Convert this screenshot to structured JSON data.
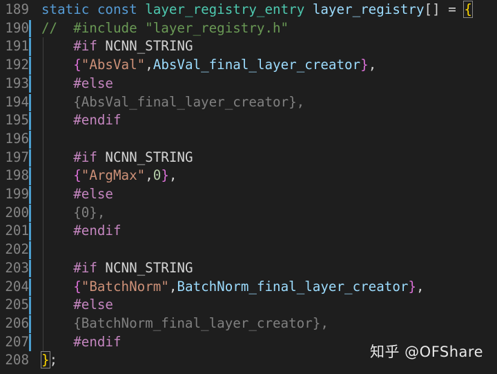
{
  "editor": {
    "lines": [
      {
        "num": "189",
        "tokens": [
          {
            "t": "static",
            "c": "kw"
          },
          {
            "t": " ",
            "c": "plain"
          },
          {
            "t": "const",
            "c": "kw"
          },
          {
            "t": " ",
            "c": "plain"
          },
          {
            "t": "layer_registry_entry",
            "c": "type"
          },
          {
            "t": " ",
            "c": "plain"
          },
          {
            "t": "layer_registry",
            "c": "var"
          },
          {
            "t": "[] = ",
            "c": "plain"
          },
          {
            "t": "{",
            "c": "bracket-box"
          }
        ]
      },
      {
        "num": "190",
        "tokens": [
          {
            "t": "//  #include \"layer_registry.h\"",
            "c": "comment"
          }
        ]
      },
      {
        "num": "191",
        "tokens": [
          {
            "t": "    ",
            "c": "plain"
          },
          {
            "t": "#if",
            "c": "pre"
          },
          {
            "t": " NCNN_STRING",
            "c": "macro"
          }
        ]
      },
      {
        "num": "192",
        "tokens": [
          {
            "t": "    ",
            "c": "plain"
          },
          {
            "t": "{",
            "c": "bracket2"
          },
          {
            "t": "\"AbsVal\"",
            "c": "str"
          },
          {
            "t": ",",
            "c": "plain"
          },
          {
            "t": "AbsVal_final_layer_creator",
            "c": "var"
          },
          {
            "t": "}",
            "c": "bracket2"
          },
          {
            "t": ",",
            "c": "plain"
          }
        ]
      },
      {
        "num": "193",
        "tokens": [
          {
            "t": "    ",
            "c": "plain"
          },
          {
            "t": "#else",
            "c": "pre"
          }
        ]
      },
      {
        "num": "194",
        "tokens": [
          {
            "t": "    {AbsVal_final_layer_creator},",
            "c": "inactive"
          }
        ]
      },
      {
        "num": "195",
        "tokens": [
          {
            "t": "    ",
            "c": "plain"
          },
          {
            "t": "#endif",
            "c": "pre"
          }
        ]
      },
      {
        "num": "196",
        "tokens": []
      },
      {
        "num": "197",
        "tokens": [
          {
            "t": "    ",
            "c": "plain"
          },
          {
            "t": "#if",
            "c": "pre"
          },
          {
            "t": " NCNN_STRING",
            "c": "macro"
          }
        ]
      },
      {
        "num": "198",
        "tokens": [
          {
            "t": "    ",
            "c": "plain"
          },
          {
            "t": "{",
            "c": "bracket2"
          },
          {
            "t": "\"ArgMax\"",
            "c": "str"
          },
          {
            "t": ",",
            "c": "plain"
          },
          {
            "t": "0",
            "c": "num"
          },
          {
            "t": "}",
            "c": "bracket2"
          },
          {
            "t": ",",
            "c": "plain"
          }
        ]
      },
      {
        "num": "199",
        "tokens": [
          {
            "t": "    ",
            "c": "plain"
          },
          {
            "t": "#else",
            "c": "pre"
          }
        ]
      },
      {
        "num": "200",
        "tokens": [
          {
            "t": "    {0},",
            "c": "inactive"
          }
        ]
      },
      {
        "num": "201",
        "tokens": [
          {
            "t": "    ",
            "c": "plain"
          },
          {
            "t": "#endif",
            "c": "pre"
          }
        ]
      },
      {
        "num": "202",
        "tokens": []
      },
      {
        "num": "203",
        "tokens": [
          {
            "t": "    ",
            "c": "plain"
          },
          {
            "t": "#if",
            "c": "pre"
          },
          {
            "t": " NCNN_STRING",
            "c": "macro"
          }
        ]
      },
      {
        "num": "204",
        "tokens": [
          {
            "t": "    ",
            "c": "plain"
          },
          {
            "t": "{",
            "c": "bracket2"
          },
          {
            "t": "\"BatchNorm\"",
            "c": "str"
          },
          {
            "t": ",",
            "c": "plain"
          },
          {
            "t": "BatchNorm_final_layer_creator",
            "c": "var"
          },
          {
            "t": "}",
            "c": "bracket2"
          },
          {
            "t": ",",
            "c": "plain"
          }
        ]
      },
      {
        "num": "205",
        "tokens": [
          {
            "t": "    ",
            "c": "plain"
          },
          {
            "t": "#else",
            "c": "pre"
          }
        ]
      },
      {
        "num": "206",
        "tokens": [
          {
            "t": "    {BatchNorm_final_layer_creator},",
            "c": "inactive"
          }
        ]
      },
      {
        "num": "207",
        "tokens": [
          {
            "t": "    ",
            "c": "plain"
          },
          {
            "t": "#endif",
            "c": "pre"
          }
        ]
      },
      {
        "num": "208",
        "tokens": [
          {
            "t": "}",
            "c": "bracket-box"
          },
          {
            "t": ";",
            "c": "plain"
          }
        ]
      }
    ],
    "modified_lines": [
      "190",
      "191",
      "192",
      "193",
      "194",
      "195",
      "196",
      "197",
      "198",
      "199",
      "200",
      "201",
      "202",
      "203",
      "204",
      "205",
      "206",
      "207"
    ]
  },
  "watermark": {
    "text": "知乎 @OFShare"
  },
  "colors": {
    "background": "#1e1e1e",
    "line_number": "#858585",
    "keyword": "#569cd6",
    "type": "#4ec9b0",
    "variable": "#9cdcfe",
    "comment": "#6a9955",
    "preprocessor": "#c586c0",
    "string": "#ce9178",
    "number": "#b5cea8",
    "inactive": "#808080",
    "modified_bar": "#4c9fd0"
  }
}
